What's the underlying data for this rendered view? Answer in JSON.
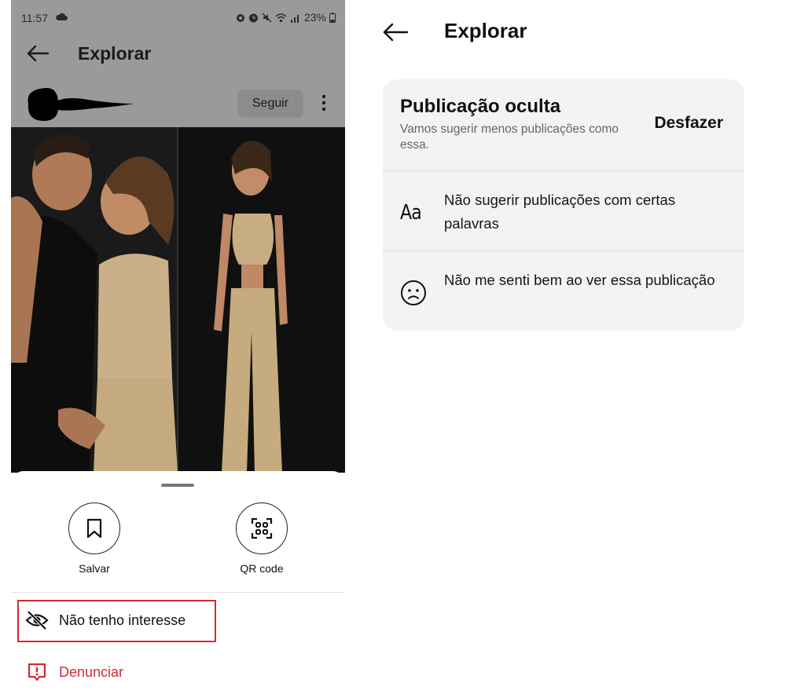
{
  "left_screen": {
    "status": {
      "time": "11:57",
      "battery": "23%"
    },
    "header": {
      "title": "Explorar",
      "back_icon": "arrow-left-icon"
    },
    "post": {
      "follow_label": "Seguir",
      "more_icon": "more-vertical-icon"
    },
    "sheet": {
      "save_label": "Salvar",
      "qr_label": "QR code",
      "not_interested_label": "Não tenho interesse",
      "report_label": "Denunciar"
    }
  },
  "right_screen": {
    "header": {
      "title": "Explorar"
    },
    "hidden_post": {
      "title": "Publicação oculta",
      "subtitle": "Vamos sugerir menos publicações como essa.",
      "undo_label": "Desfazer"
    },
    "options": [
      {
        "icon_text": "Aa",
        "label": "Não sugerir publicações com certas palavras"
      },
      {
        "icon": "sad-face-icon",
        "label": "Não me senti bem ao ver essa publicação"
      }
    ]
  },
  "colors": {
    "dim_overlay": "#9a9a9a",
    "highlight_border": "#d9262e",
    "report_red": "#d42a36",
    "card_bg": "#f3f3f3"
  }
}
